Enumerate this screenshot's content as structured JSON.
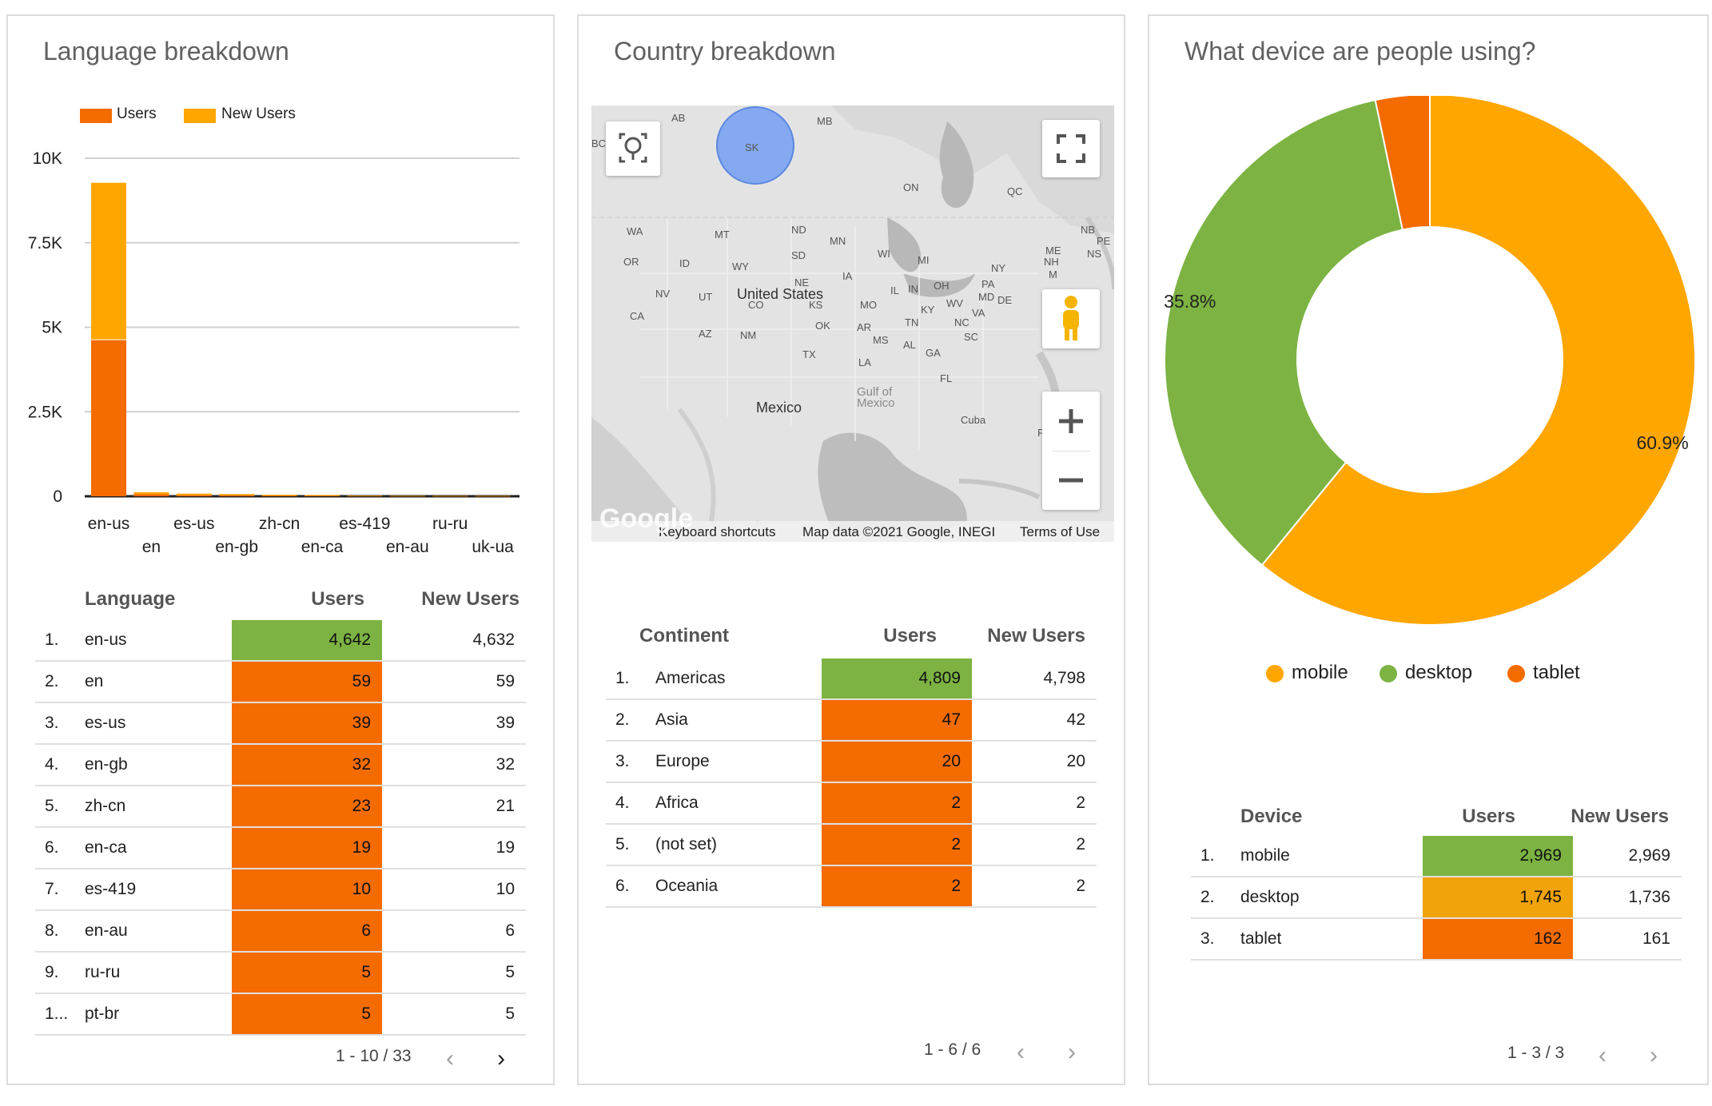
{
  "language": {
    "title": "Language breakdown",
    "legend": [
      {
        "label": "Users",
        "color": "#f46b00"
      },
      {
        "label": "New Users",
        "color": "#ffa600"
      }
    ],
    "table": {
      "headers": [
        "Language",
        "Users",
        "New Users"
      ],
      "rows": [
        {
          "idx": "1.",
          "name": "en-us",
          "users": "4,642",
          "new": "4,632",
          "highlight": true
        },
        {
          "idx": "2.",
          "name": "en",
          "users": "59",
          "new": "59"
        },
        {
          "idx": "3.",
          "name": "es-us",
          "users": "39",
          "new": "39"
        },
        {
          "idx": "4.",
          "name": "en-gb",
          "users": "32",
          "new": "32"
        },
        {
          "idx": "5.",
          "name": "zh-cn",
          "users": "23",
          "new": "21"
        },
        {
          "idx": "6.",
          "name": "en-ca",
          "users": "19",
          "new": "19"
        },
        {
          "idx": "7.",
          "name": "es-419",
          "users": "10",
          "new": "10"
        },
        {
          "idx": "8.",
          "name": "en-au",
          "users": "6",
          "new": "6"
        },
        {
          "idx": "9.",
          "name": "ru-ru",
          "users": "5",
          "new": "5"
        },
        {
          "idx": "1...",
          "name": "pt-br",
          "users": "5",
          "new": "5"
        }
      ],
      "pager": "1 - 10 / 33"
    }
  },
  "country": {
    "title": "Country breakdown",
    "map": {
      "keyboard": "Keyboard shortcuts",
      "mapdata": "Map data ©2021 Google, INEGI",
      "terms": "Terms of Use",
      "google": "Google"
    },
    "table": {
      "headers": [
        "Continent",
        "Users",
        "New Users"
      ],
      "rows": [
        {
          "idx": "1.",
          "name": "Americas",
          "users": "4,809",
          "new": "4,798",
          "highlight": true
        },
        {
          "idx": "2.",
          "name": "Asia",
          "users": "47",
          "new": "42"
        },
        {
          "idx": "3.",
          "name": "Europe",
          "users": "20",
          "new": "20"
        },
        {
          "idx": "4.",
          "name": "Africa",
          "users": "2",
          "new": "2"
        },
        {
          "idx": "5.",
          "name": "(not set)",
          "users": "2",
          "new": "2"
        },
        {
          "idx": "6.",
          "name": "Oceania",
          "users": "2",
          "new": "2"
        }
      ],
      "pager": "1 - 6 / 6"
    }
  },
  "device": {
    "title": "What device are people using?",
    "table": {
      "headers": [
        "Device",
        "Users",
        "New Users"
      ],
      "rows": [
        {
          "idx": "1.",
          "name": "mobile",
          "users": "2,969",
          "new": "2,969",
          "color": "#7cb342"
        },
        {
          "idx": "2.",
          "name": "desktop",
          "users": "1,745",
          "new": "1,736",
          "color": "#f0a30a"
        },
        {
          "idx": "3.",
          "name": "tablet",
          "users": "162",
          "new": "161",
          "color": "#f46b00"
        }
      ],
      "pager": "1 - 3 / 3"
    }
  },
  "chart_data": [
    {
      "type": "bar",
      "stacked": true,
      "title": "Language breakdown",
      "categories": [
        "en-us",
        "en",
        "es-us",
        "en-gb",
        "zh-cn",
        "en-ca",
        "es-419",
        "en-au",
        "ru-ru",
        "uk-ua"
      ],
      "series": [
        {
          "name": "Users",
          "color": "#f46b00",
          "values": [
            4642,
            59,
            39,
            32,
            23,
            19,
            10,
            6,
            5,
            5
          ]
        },
        {
          "name": "New Users",
          "color": "#ffa600",
          "values": [
            4632,
            59,
            39,
            32,
            21,
            19,
            10,
            6,
            5,
            5
          ]
        }
      ],
      "yticks": [
        "10K",
        "7.5K",
        "5K",
        "2.5K",
        "0"
      ],
      "ytick_values": [
        10000,
        7500,
        5000,
        2500,
        0
      ],
      "ylim": [
        0,
        10000
      ],
      "grid": true,
      "legend": "top-left"
    },
    {
      "type": "pie",
      "donut": true,
      "title": "What device are people using?",
      "labels": [
        "mobile",
        "desktop",
        "tablet"
      ],
      "values": [
        60.9,
        35.8,
        3.3
      ],
      "value_labels": [
        "60.9%",
        "35.8%",
        ""
      ],
      "colors": [
        "#ffa600",
        "#7cb342",
        "#f46b00"
      ],
      "legend": "bottom"
    }
  ],
  "map_labels": [
    {
      "t": "AB"
    },
    {
      "t": "MB"
    },
    {
      "t": "SK"
    },
    {
      "t": "BC"
    },
    {
      "t": "ON"
    },
    {
      "t": "QC"
    },
    {
      "t": "WA"
    },
    {
      "t": "MT"
    },
    {
      "t": "ND"
    },
    {
      "t": "MN"
    },
    {
      "t": "NB"
    },
    {
      "t": "PE"
    },
    {
      "t": "OR"
    },
    {
      "t": "ID"
    },
    {
      "t": "WY"
    },
    {
      "t": "SD"
    },
    {
      "t": "WI"
    },
    {
      "t": "MI"
    },
    {
      "t": "ME"
    },
    {
      "t": "NS"
    },
    {
      "t": "NH"
    },
    {
      "t": "NY"
    },
    {
      "t": "M"
    },
    {
      "t": "NE"
    },
    {
      "t": "IA"
    },
    {
      "t": "IL"
    },
    {
      "t": "NV"
    },
    {
      "t": "UT"
    },
    {
      "t": "United States"
    },
    {
      "t": "IN"
    },
    {
      "t": "OH"
    },
    {
      "t": "PA"
    },
    {
      "t": "MD"
    },
    {
      "t": "DE"
    },
    {
      "t": "CA"
    },
    {
      "t": "CO"
    },
    {
      "t": "KS"
    },
    {
      "t": "MO"
    },
    {
      "t": "KY"
    },
    {
      "t": "WV"
    },
    {
      "t": "VA"
    },
    {
      "t": "OK"
    },
    {
      "t": "AR"
    },
    {
      "t": "TN"
    },
    {
      "t": "NC"
    },
    {
      "t": "AZ"
    },
    {
      "t": "NM"
    },
    {
      "t": "MS"
    },
    {
      "t": "AL"
    },
    {
      "t": "SC"
    },
    {
      "t": "GA"
    },
    {
      "t": "TX"
    },
    {
      "t": "LA"
    },
    {
      "t": "FL"
    },
    {
      "t": "Gulf of"
    },
    {
      "t": "Mexico"
    },
    {
      "t": "Mexico"
    },
    {
      "t": "Cuba"
    },
    {
      "t": "Puerto Rico"
    }
  ]
}
